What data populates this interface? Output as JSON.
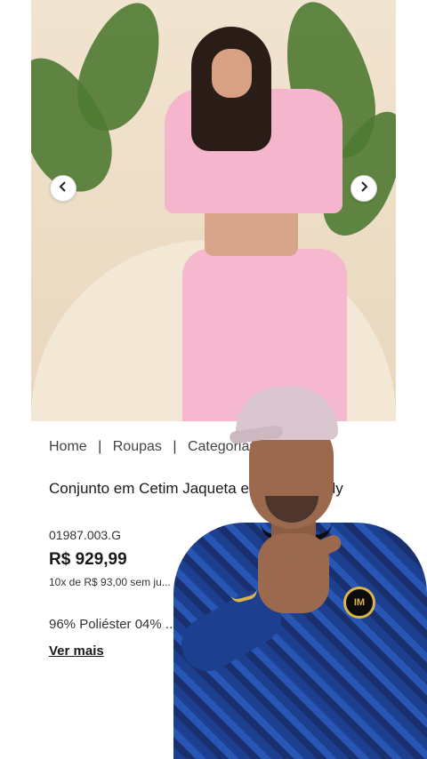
{
  "carousel": {
    "prev_icon": "chevron-left-icon",
    "next_icon": "chevron-right-icon"
  },
  "breadcrumb": {
    "items": [
      "Home",
      "Roupas",
      "Categorias"
    ],
    "separator": "|"
  },
  "product": {
    "title": "Conjunto em Cetim Jaqueta e ... mber Kady",
    "sku": "01987.003.G",
    "price": "R$ 929,99",
    "installments": "10x de R$ 93,00 sem ju...",
    "composition": "96% Poliéster 04% ...",
    "more_link": "Ver mais"
  },
  "overlay": {
    "badge_text": "IM"
  },
  "colors": {
    "accent_pink": "#f4b5cd",
    "shirt_blue": "#1c3f8f",
    "badge_gold": "#d8b44a"
  }
}
